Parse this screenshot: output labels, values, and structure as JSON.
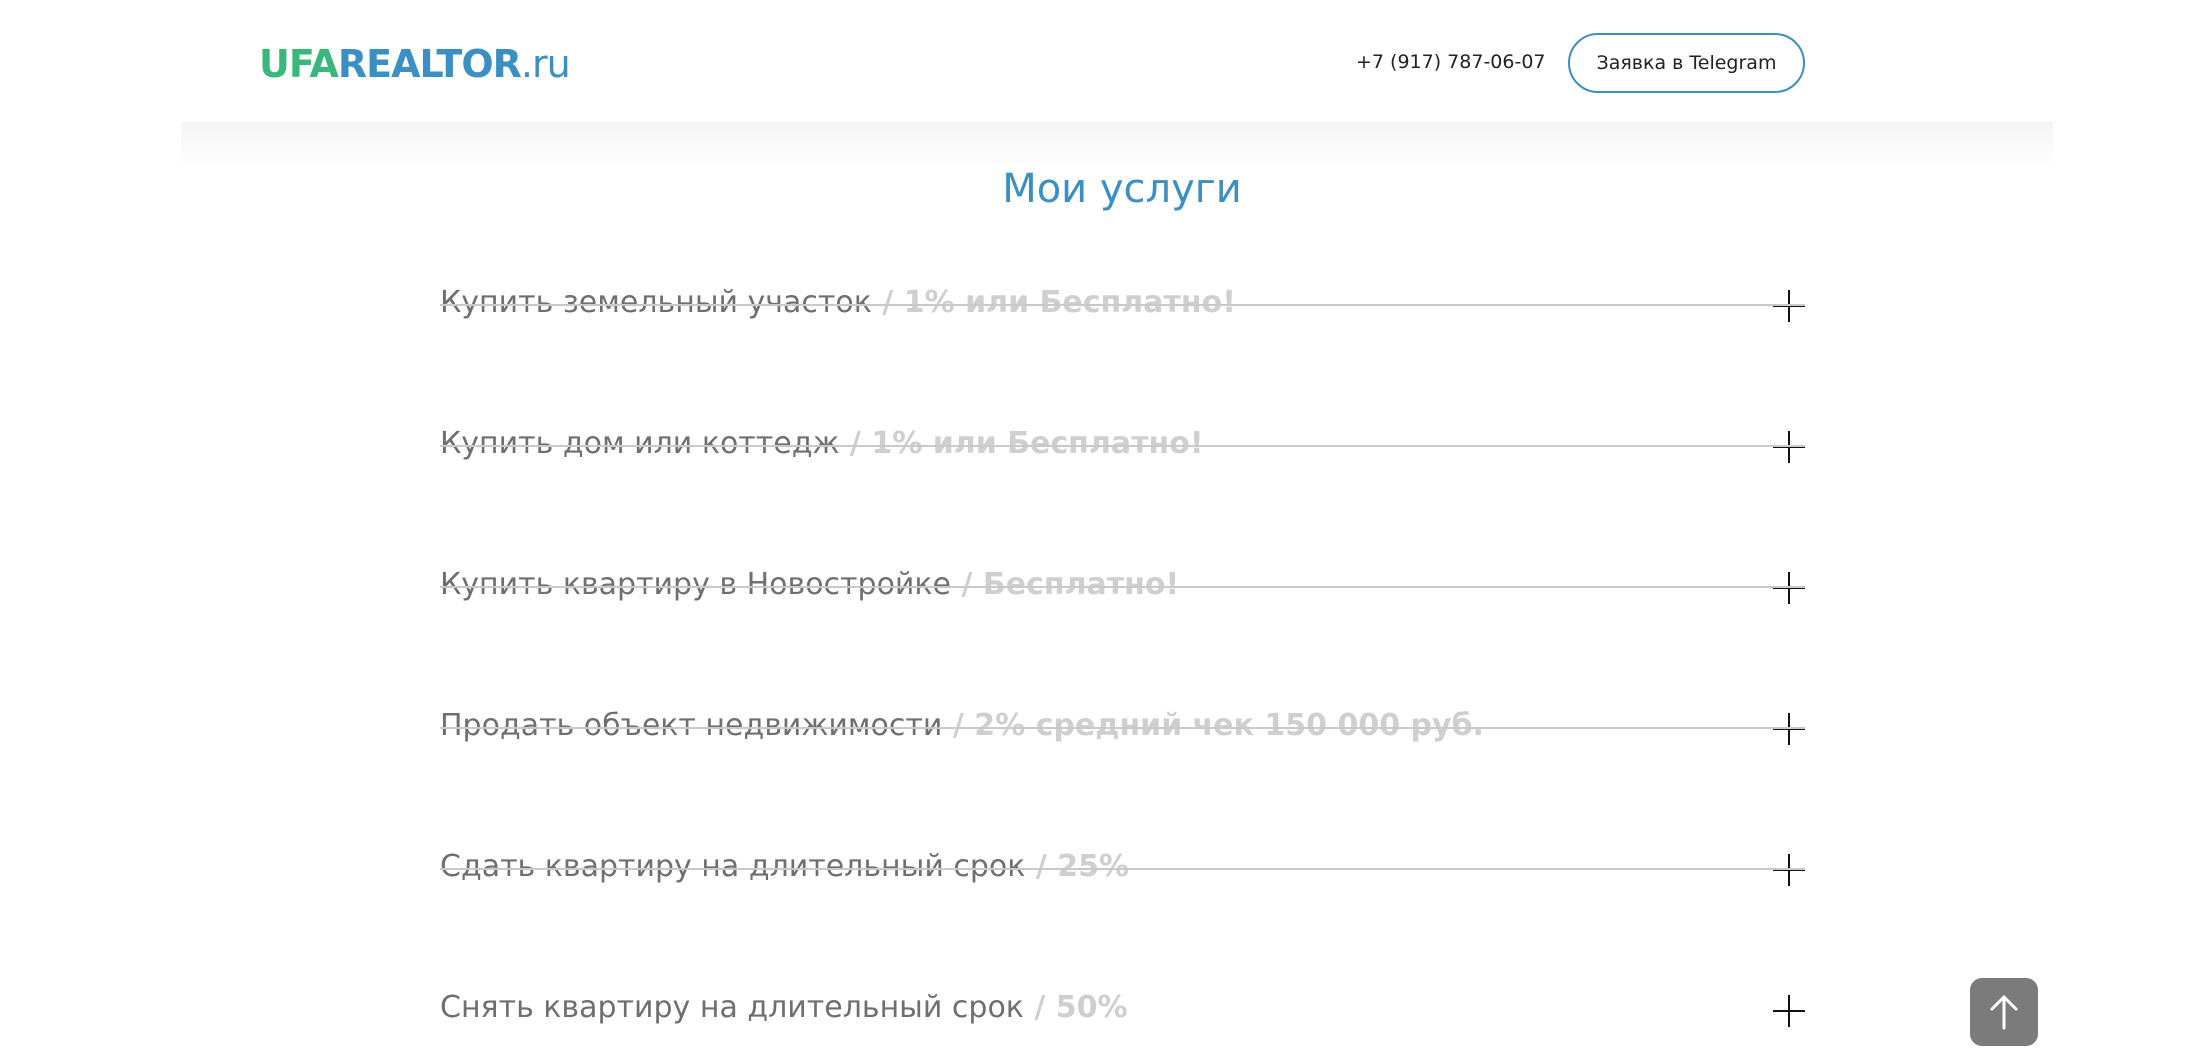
{
  "header": {
    "logo": {
      "part1": "UFA",
      "part2": "REALTOR",
      "part3": ".ru"
    },
    "phone": "+7 (917) 787-06-07",
    "telegram_button_label": "Заявка в Telegram"
  },
  "services": {
    "title": "Мои услуги",
    "items": [
      {
        "name": "Купить земельный участок",
        "price": " / 1% или Бесплатно!"
      },
      {
        "name": "Купить дом или коттедж",
        "price": " / 1% или Бесплатно!"
      },
      {
        "name": "Купить квартиру в Новостройке",
        "price": " / Бесплатно!"
      },
      {
        "name": "Продать объект недвижимости",
        "price": " / 2% средний чек 150 000 руб."
      },
      {
        "name": "Сдать квартиру на длительный срок",
        "price": " / 25%"
      },
      {
        "name": "Снять квартиру на длительный срок",
        "price": " / 50%"
      }
    ]
  },
  "colors": {
    "accent_blue": "#3b8fc2",
    "accent_green": "#3ab77a",
    "text_gray": "#6f6f6f",
    "price_gray": "#cfcfcf",
    "scroll_button": "#7b7b7b"
  },
  "icons": {
    "expand": "plus-icon",
    "scroll_top": "arrow-up-icon"
  }
}
